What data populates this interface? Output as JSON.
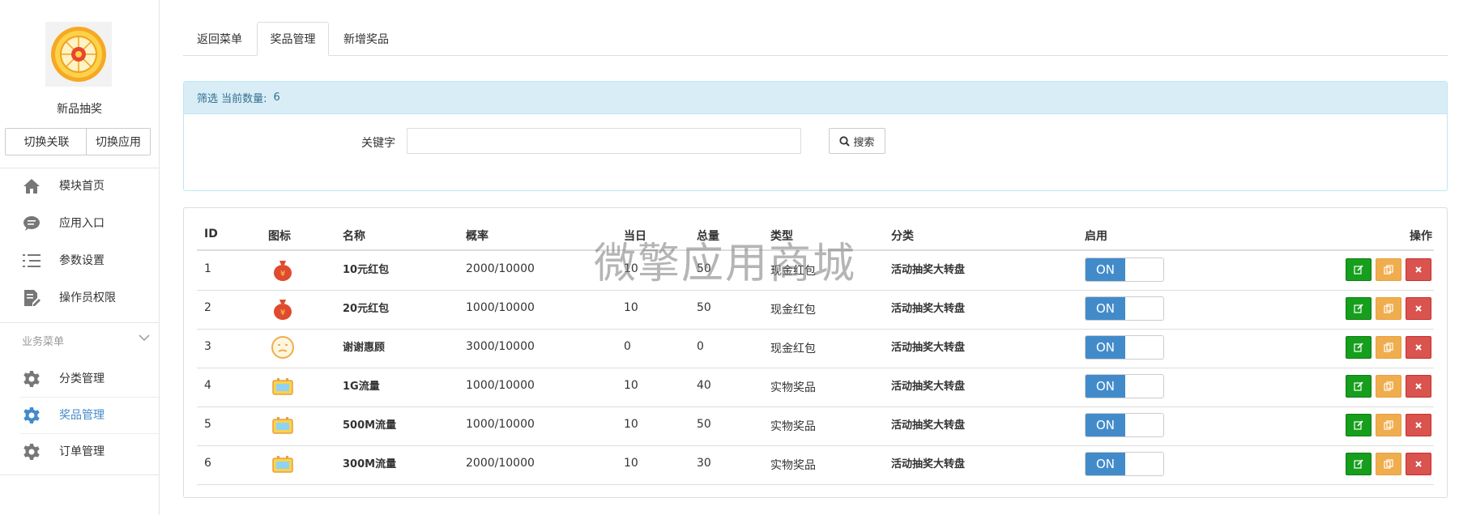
{
  "sidebar": {
    "app_name": "新品抽奖",
    "switch_link_label": "切换关联",
    "switch_app_label": "切换应用",
    "nav": [
      {
        "label": "模块首页",
        "icon": "home-icon"
      },
      {
        "label": "应用入口",
        "icon": "chat-bubble-icon"
      },
      {
        "label": "参数设置",
        "icon": "list-settings-icon"
      },
      {
        "label": "操作员权限",
        "icon": "edit-document-icon"
      }
    ],
    "section_title": "业务菜单",
    "business_nav": [
      {
        "label": "分类管理",
        "icon": "gear-icon",
        "active": false
      },
      {
        "label": "奖品管理",
        "icon": "gear-icon",
        "active": true
      },
      {
        "label": "订单管理",
        "icon": "gear-icon",
        "active": false
      }
    ]
  },
  "tabs": [
    {
      "label": "返回菜单",
      "active": false
    },
    {
      "label": "奖品管理",
      "active": true
    },
    {
      "label": "新增奖品",
      "active": false
    }
  ],
  "filter": {
    "title": "筛选 当前数量:",
    "count": "6",
    "keyword_label": "关键字",
    "keyword_value": "",
    "search_label": "搜索"
  },
  "table": {
    "headers": {
      "id": "ID",
      "icon": "图标",
      "name": "名称",
      "rate": "概率",
      "today": "当日",
      "total": "总量",
      "type": "类型",
      "category": "分类",
      "enabled": "启用",
      "actions": "操作"
    },
    "rows": [
      {
        "id": "1",
        "icon": "red-envelope-bag-icon",
        "name": "10元红包",
        "rate": "2000/10000",
        "today": "10",
        "total": "50",
        "type": "现金红包",
        "category": "活动抽奖大转盘",
        "enabled": "ON"
      },
      {
        "id": "2",
        "icon": "red-envelope-bag-icon",
        "name": "20元红包",
        "rate": "1000/10000",
        "today": "10",
        "total": "50",
        "type": "现金红包",
        "category": "活动抽奖大转盘",
        "enabled": "ON"
      },
      {
        "id": "3",
        "icon": "sorry-face-icon",
        "name": "谢谢惠顾",
        "rate": "3000/10000",
        "today": "0",
        "total": "0",
        "type": "现金红包",
        "category": "活动抽奖大转盘",
        "enabled": "ON"
      },
      {
        "id": "4",
        "icon": "data-card-icon",
        "name": "1G流量",
        "rate": "1000/10000",
        "today": "10",
        "total": "40",
        "type": "实物奖品",
        "category": "活动抽奖大转盘",
        "enabled": "ON"
      },
      {
        "id": "5",
        "icon": "data-card-icon",
        "name": "500M流量",
        "rate": "1000/10000",
        "today": "10",
        "total": "50",
        "type": "实物奖品",
        "category": "活动抽奖大转盘",
        "enabled": "ON"
      },
      {
        "id": "6",
        "icon": "data-card-icon",
        "name": "300M流量",
        "rate": "2000/10000",
        "today": "10",
        "total": "30",
        "type": "实物奖品",
        "category": "活动抽奖大转盘",
        "enabled": "ON"
      }
    ]
  },
  "watermark": "微擎应用商城",
  "colors": {
    "primary": "#428bca",
    "edit": "#169f1c",
    "copy": "#f0ad4e",
    "delete": "#d9534f",
    "info_bg": "#d9edf7"
  }
}
